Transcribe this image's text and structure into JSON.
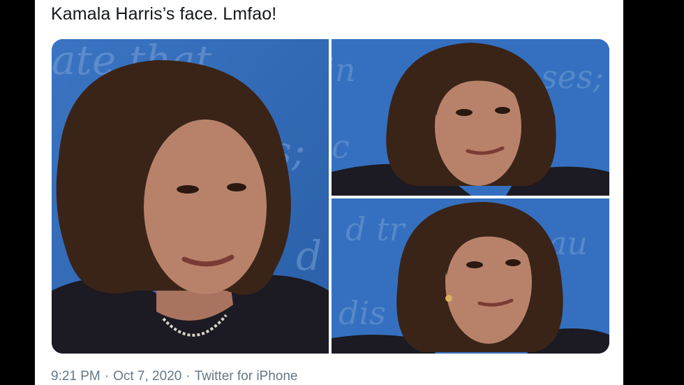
{
  "tweet": {
    "text": "Kamala Harris’s face. Lmfao!",
    "time": "9:21 PM",
    "separator": "·",
    "date": "Oct 7, 2020",
    "source": "Twitter for iPhone"
  },
  "media": {
    "images": [
      {
        "name": "photo-left"
      },
      {
        "name": "photo-top-right"
      },
      {
        "name": "photo-bottom-right"
      }
    ],
    "colors": {
      "backdrop_blue": "#2f69b7",
      "backdrop_text": "#7fa6dc",
      "hair": "#3a2418",
      "skin": "#b8826a",
      "jacket": "#1c1a22"
    }
  },
  "colors": {
    "text": "#14171a",
    "meta": "#657786",
    "frame": "#000000"
  }
}
